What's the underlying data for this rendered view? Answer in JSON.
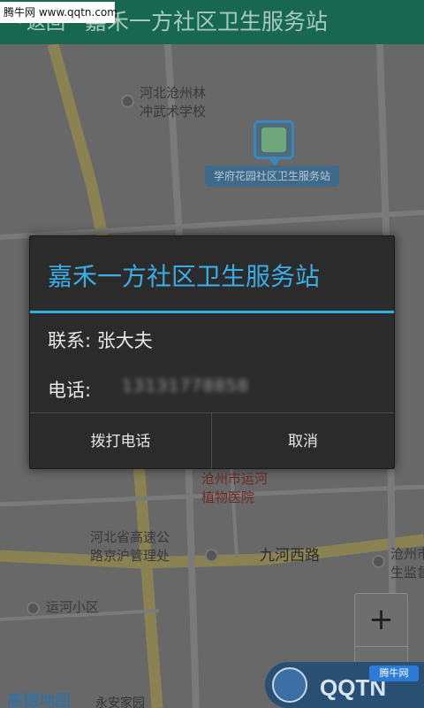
{
  "header": {
    "back_glyph": "<",
    "back_label": "返回",
    "title": "嘉禾一方社区卫生服务站"
  },
  "watermark_top": "腾牛网 www.qqtn.com",
  "map": {
    "pois": [
      {
        "label": "河北沧州林\n冲武术学校"
      },
      {
        "label": "沧州市运河\n植物医院"
      },
      {
        "label": "河北省高速公\n路京沪管理处"
      },
      {
        "label": "九河西路"
      },
      {
        "label": "沧州市\n生监督"
      },
      {
        "label": "运河小区"
      }
    ],
    "marker_label": "学府花园社区卫生服务站",
    "zoom_in": "+",
    "logo": "高德地图",
    "bottom_text": "永安家园"
  },
  "dialog": {
    "title": "嘉禾一方社区卫生服务站",
    "contact_label": "联系: 张大夫",
    "phone_label": "电话:",
    "phone_value": "13131778858",
    "call_button": "拨打电话",
    "cancel_button": "取消"
  },
  "watermark_bottom": {
    "text": "QQTN",
    "badge": "腾牛网"
  },
  "colors": {
    "header_bg": "#18684f",
    "dialog_accent": "#33b0e3",
    "dialog_bg": "#2b2b2b"
  }
}
